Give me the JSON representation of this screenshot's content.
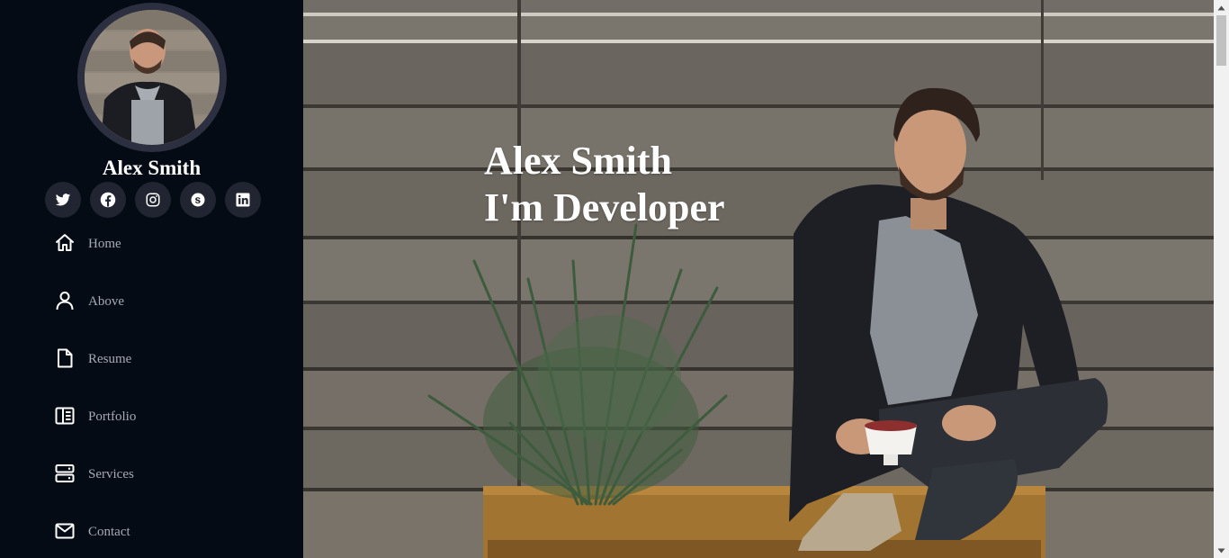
{
  "profile": {
    "name": "Alex Smith"
  },
  "social": [
    {
      "icon": "twitter-icon"
    },
    {
      "icon": "facebook-icon"
    },
    {
      "icon": "instagram-icon"
    },
    {
      "icon": "skype-icon"
    },
    {
      "icon": "linkedin-icon"
    }
  ],
  "nav": {
    "items": [
      {
        "label": "Home",
        "icon": "home-icon"
      },
      {
        "label": "Above",
        "icon": "user-icon"
      },
      {
        "label": "Resume",
        "icon": "file-icon"
      },
      {
        "label": "Portfolio",
        "icon": "portfolio-icon"
      },
      {
        "label": "Services",
        "icon": "server-icon"
      },
      {
        "label": "Contact",
        "icon": "envelope-icon"
      }
    ]
  },
  "hero": {
    "line1": "Alex Smith",
    "line2": "I'm Developer"
  },
  "colors": {
    "sidebar_bg": "#040b14",
    "social_bg": "#212431",
    "nav_text": "#a8a9b4",
    "avatar_ring": "#2c2f3f"
  }
}
